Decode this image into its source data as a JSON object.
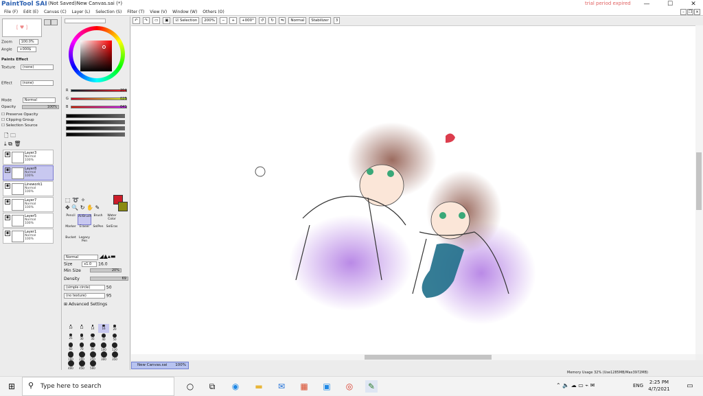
{
  "window": {
    "app_logo": "PaintTool SAI",
    "title": "(Not Saved)New Canvas.sai (*)",
    "trial_notice": "trial period expired",
    "minimize": "—",
    "maximize": "☐",
    "close": "✕"
  },
  "menu": [
    "File (F)",
    "Edit (E)",
    "Canvas (C)",
    "Layer (L)",
    "Selection (S)",
    "Filter (T)",
    "View (V)",
    "Window (W)",
    "Others (O)"
  ],
  "navigator": {
    "zoom_label": "Zoom",
    "zoom_value": "100.0%",
    "angle_label": "Angle",
    "angle_value": "+000$"
  },
  "paint_effect": {
    "header": "Paints Effect",
    "texture_label": "Texture",
    "texture_value": "(none)",
    "effect_label": "Effect",
    "effect_value": "(none)",
    "mode_label": "Mode",
    "mode_value": "Normal",
    "opacity_label": "Opacity",
    "opacity_value": "100%",
    "preserve_opacity": "Preserve Opacity",
    "clipping_group": "Clipping Group",
    "selection_source": "Selection Source"
  },
  "layers": [
    {
      "name": "Layer3",
      "mode": "Normal",
      "opacity": "100%",
      "selected": false
    },
    {
      "name": "Layer8",
      "mode": "Normal",
      "opacity": "100%",
      "selected": true
    },
    {
      "name": "Linework1",
      "mode": "Normal",
      "opacity": "100%",
      "selected": false
    },
    {
      "name": "Layer7",
      "mode": "Normal",
      "opacity": "100%",
      "selected": false
    },
    {
      "name": "Layer5",
      "mode": "Normal",
      "opacity": "100%",
      "selected": false
    },
    {
      "name": "Layer1",
      "mode": "Normal",
      "opacity": "100%",
      "selected": false
    }
  ],
  "color": {
    "r_label": "R",
    "r_value": "204",
    "g_label": "G",
    "g_value": "028",
    "b_label": "B",
    "b_value": "041",
    "primary": "#cc1c29",
    "secondary": "#8a8a10"
  },
  "tools": {
    "row1": [
      "Pencil",
      "AirBrush",
      "Brush",
      "Water Color"
    ],
    "row2": [
      "Marker",
      "Eraser",
      "SelPen",
      "SelEras"
    ],
    "row3": [
      "Bucket",
      "Legacy Pen"
    ],
    "selected": "AirBrush"
  },
  "brush": {
    "mode": "Normal",
    "size_label": "Size",
    "size_mult": "x1.0",
    "size_value": "16.0",
    "min_size_label": "Min Size",
    "min_size_value": "20%",
    "density_label": "Density",
    "density_value": "69",
    "shape": "(simple circle)",
    "shape_value": "50",
    "texture": "(no texture)",
    "texture_value": "95",
    "advanced": "Advanced Settings",
    "presets": [
      "10",
      "12",
      "14",
      "16",
      "20",
      "25",
      "30",
      "35",
      "40",
      "50",
      "60",
      "70",
      "80",
      "100",
      "120",
      "160",
      "200",
      "250",
      "300",
      "350",
      "400",
      "450",
      "500"
    ]
  },
  "toolbar": {
    "selection_label": "Selection",
    "zoom": "200%",
    "angle": "+000°",
    "blend": "Normal",
    "stabilizer_label": "Stabilizer",
    "stabilizer_value": "3"
  },
  "document_tab": {
    "name": "New Canvas.sai",
    "zoom": "100%"
  },
  "status": {
    "memory": "Memory Usage 32% (Use1285MB/Max3972MB)"
  },
  "taskbar": {
    "search_placeholder": "Type here to search",
    "time": "2:25 PM",
    "date": "4/7/2021",
    "lang": "ENG"
  }
}
